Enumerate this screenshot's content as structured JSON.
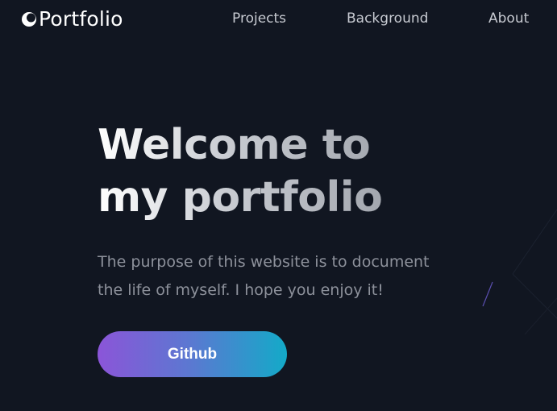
{
  "header": {
    "brand": "Portfolio",
    "nav": [
      {
        "label": "Projects"
      },
      {
        "label": "Background"
      },
      {
        "label": "About"
      }
    ]
  },
  "hero": {
    "title_line1": "Welcome to",
    "title_line2": "my portfolio",
    "subtitle_line1": "The purpose of this website is to document",
    "subtitle_line2": "the life of myself. I hope you enjoy it!",
    "cta_label": "Github"
  },
  "colors": {
    "background": "#111621",
    "button_gradient_start": "#8b55d8",
    "button_gradient_end": "#13aac8",
    "nav_text": "#c7cad1",
    "subtitle_text": "#8d919b"
  },
  "icons": {
    "brand_logo": "crescent-logo-icon"
  }
}
